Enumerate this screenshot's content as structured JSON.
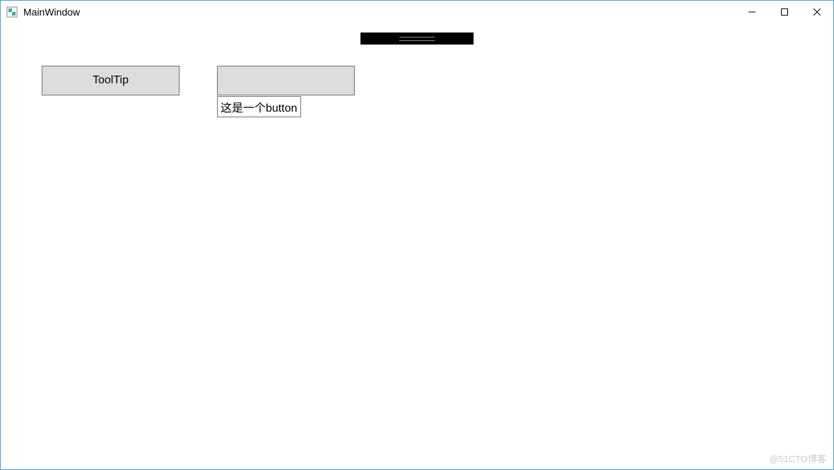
{
  "window": {
    "title": "MainWindow"
  },
  "buttons": {
    "tooltip_button_label": "ToolTip",
    "second_button_label": ""
  },
  "tooltip": {
    "text": "这是一个button"
  },
  "watermark": "@51CTO博客"
}
